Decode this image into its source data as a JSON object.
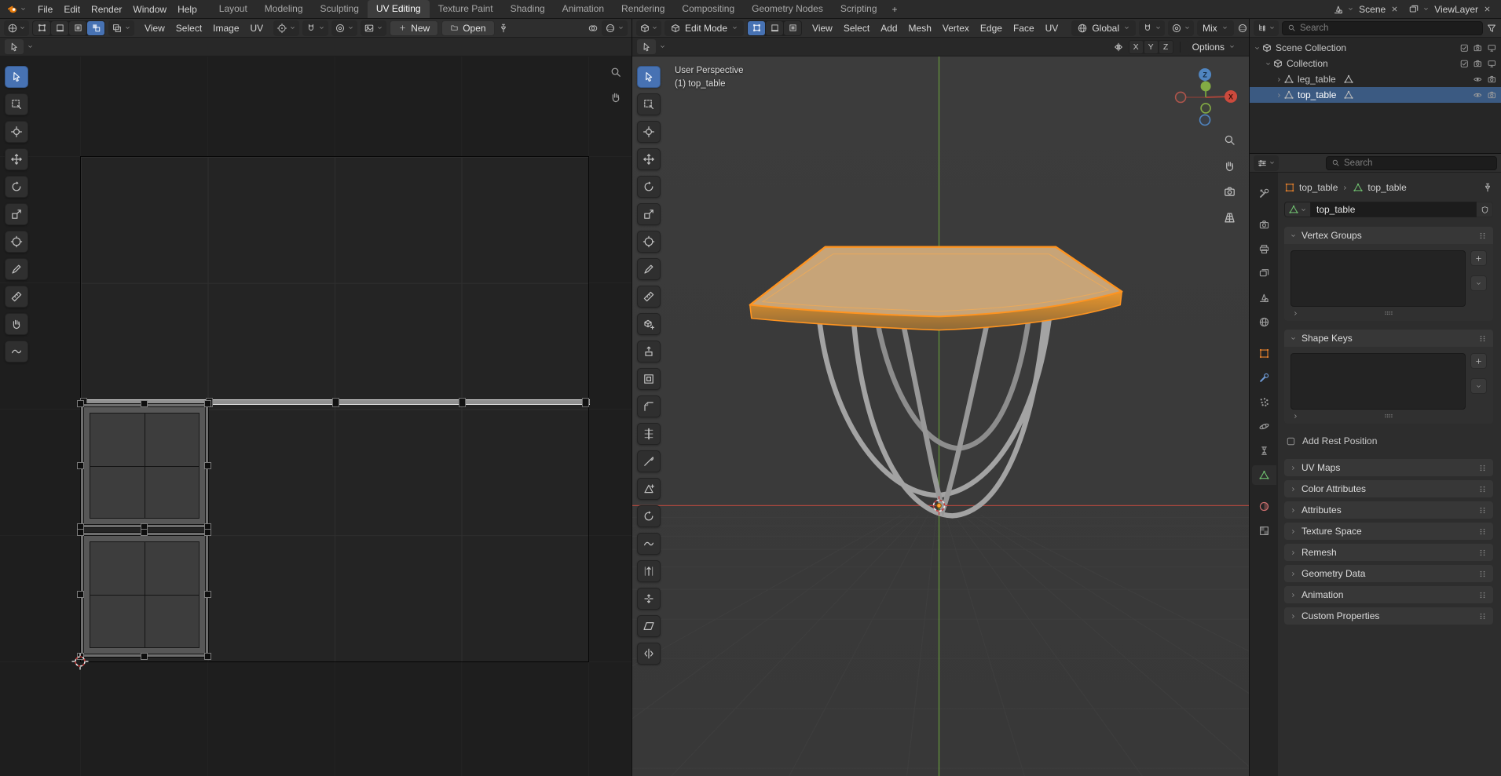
{
  "colors": {
    "accent_orange": "#e87d0d",
    "selection_blue": "#4772b3",
    "selected_mesh_outline": "#ff9420",
    "axis_x_red": "#c4473d",
    "axis_y_green": "#76a036",
    "axis_z_blue": "#3f6fae"
  },
  "topbar": {
    "menus": [
      "File",
      "Edit",
      "Render",
      "Window",
      "Help"
    ],
    "workspaces": [
      "Layout",
      "Modeling",
      "Sculpting",
      "UV Editing",
      "Texture Paint",
      "Shading",
      "Animation",
      "Rendering",
      "Compositing",
      "Geometry Nodes",
      "Scripting"
    ],
    "active_workspace": "UV Editing",
    "add_workspace": "+",
    "scene_label": "Scene",
    "viewlayer_label": "ViewLayer"
  },
  "uv_editor": {
    "menus": [
      "View",
      "Select",
      "Image",
      "UV"
    ],
    "new_button": "New",
    "open_button": "Open",
    "select_modes": [
      "vertex",
      "edge",
      "face",
      "island"
    ],
    "active_select_mode": "island",
    "tools": [
      "tweak",
      "select-box",
      "cursor",
      "move",
      "rotate",
      "scale",
      "transform",
      "annotate",
      "measure",
      "grab",
      "relax"
    ],
    "active_tool": "tweak"
  },
  "viewport": {
    "mode": "Edit Mode",
    "menus": [
      "View",
      "Select",
      "Add",
      "Mesh",
      "Vertex",
      "Edge",
      "Face",
      "UV"
    ],
    "select_modes": [
      "vertex",
      "edge",
      "face"
    ],
    "active_select_mode": "vertex",
    "orientation": "Global",
    "proportional_falloff": "Mix",
    "mirror": {
      "x": "X",
      "y": "Y",
      "z": "Z"
    },
    "options": "Options",
    "overlay": {
      "line1": "User Perspective",
      "line2": "(1) top_table"
    },
    "gizmo": {
      "x": "X",
      "z": "Z"
    },
    "tools": [
      "tweak",
      "select-box",
      "cursor",
      "move",
      "rotate",
      "scale",
      "transform",
      "annotate",
      "measure",
      "add-cube",
      "extrude",
      "inset",
      "bevel",
      "loop-cut",
      "knife",
      "poly-build",
      "spin",
      "smooth",
      "edge-slide",
      "shrink-fatten",
      "shear",
      "rip-region"
    ],
    "active_tool": "tweak"
  },
  "outliner": {
    "search_placeholder": "Search",
    "rows": [
      {
        "label": "Scene Collection",
        "depth": 0,
        "type": "scene-collection",
        "expanded": true,
        "selected": false
      },
      {
        "label": "Collection",
        "depth": 1,
        "type": "collection",
        "expanded": true,
        "selected": false
      },
      {
        "label": "leg_table",
        "depth": 2,
        "type": "mesh-object",
        "expanded": false,
        "selected": false
      },
      {
        "label": "top_table",
        "depth": 2,
        "type": "mesh-object",
        "expanded": false,
        "selected": true
      }
    ]
  },
  "properties": {
    "search_placeholder": "Search",
    "tabs": [
      "tool",
      "render",
      "output",
      "view-layer",
      "scene",
      "world",
      "object",
      "modifiers",
      "particles",
      "physics",
      "constraints",
      "data",
      "material",
      "texture"
    ],
    "active_tab": "data",
    "breadcrumb": {
      "object": "top_table",
      "data": "top_table"
    },
    "name_value": "top_table",
    "open_panels": [
      {
        "label": "Vertex Groups"
      },
      {
        "label": "Shape Keys"
      }
    ],
    "add_rest_position": {
      "label": "Add Rest Position",
      "checked": false
    },
    "collapsed_panels": [
      "UV Maps",
      "Color Attributes",
      "Attributes",
      "Texture Space",
      "Remesh",
      "Geometry Data",
      "Animation",
      "Custom Properties"
    ]
  }
}
